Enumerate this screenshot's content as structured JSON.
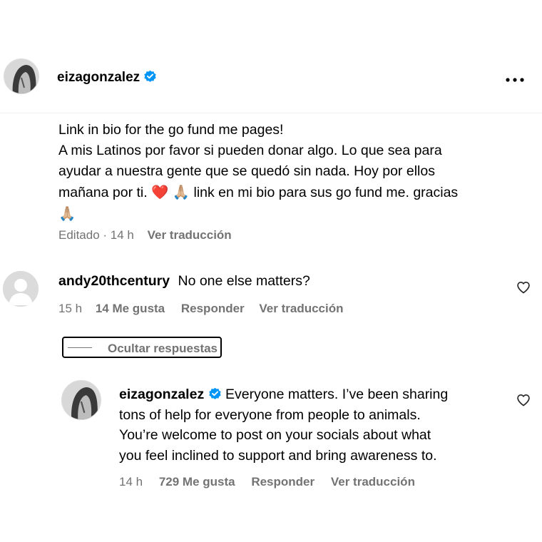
{
  "header": {
    "username": "eizagonzalez",
    "more_icon": "more-horizontal-icon"
  },
  "caption": {
    "line1": "Link in bio for the go fund me pages!",
    "line2": "A mis Latinos por favor si pueden donar algo. Lo que sea para",
    "line3": "ayudar a nuestra gente que se quedó sin nada. Hoy por ellos",
    "line4a": "mañana por ti.",
    "heart_emoji": "❤️",
    "pray_emoji": "🙏🏼",
    "line4b": "link en mi bio para sus go fund me. gracias",
    "meta_edited": "Editado · 14 h",
    "meta_translate": "Ver traducción"
  },
  "comment": {
    "username": "andy20thcentury",
    "text": "No one else matters?",
    "time": "15 h",
    "likes": "14 Me gusta",
    "reply": "Responder",
    "translate": "Ver traducción"
  },
  "hide_replies": {
    "label": "Ocultar respuestas"
  },
  "reply": {
    "username": "eizagonzalez",
    "line1": "Everyone matters. I’ve been sharing",
    "line2": "tons of help for everyone from people to animals.",
    "line3": "You’re welcome to post on your socials about what",
    "line4": "you feel inclined to support and bring awareness to.",
    "time": "14 h",
    "likes": "729 Me gusta",
    "reply": "Responder",
    "translate": "Ver traducción"
  },
  "colors": {
    "verified": "#0095f6",
    "heart": "#e0245e",
    "muted": "#737373"
  }
}
